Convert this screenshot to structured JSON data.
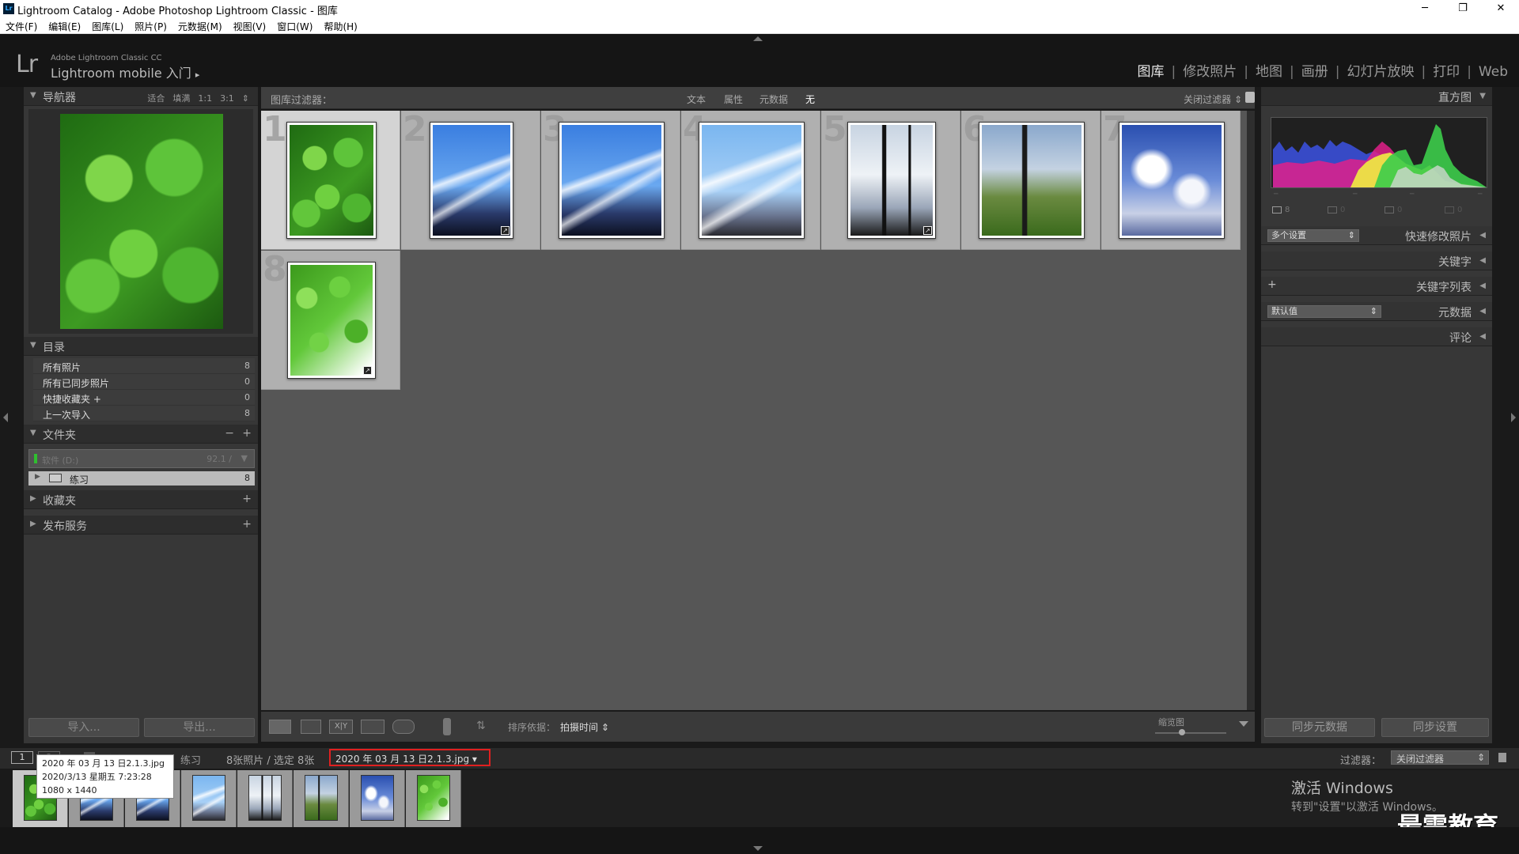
{
  "window": {
    "title": "Lightroom Catalog - Adobe Photoshop Lightroom Classic - 图库",
    "app_icon_text": "Lr"
  },
  "window_controls": {
    "minimize": "─",
    "restore": "❐",
    "close": "✕"
  },
  "menu": [
    "文件(F)",
    "编辑(E)",
    "图库(L)",
    "照片(P)",
    "元数据(M)",
    "视图(V)",
    "窗口(W)",
    "帮助(H)"
  ],
  "identity_plate": {
    "logo": "Lr",
    "line1": "Adobe Lightroom Classic CC",
    "line2": "Lightroom mobile 入门",
    "arrow": "▸"
  },
  "modules": {
    "items": [
      "图库",
      "修改照片",
      "地图",
      "画册",
      "幻灯片放映",
      "打印",
      "Web"
    ],
    "active": "图库",
    "separator": "|"
  },
  "navigator": {
    "title": "导航器",
    "options": [
      "适合",
      "填满",
      "1:1",
      "3:1"
    ],
    "spinner": "⇕"
  },
  "catalog": {
    "title": "目录",
    "items": [
      {
        "label": "所有照片",
        "count": "8"
      },
      {
        "label": "所有已同步照片",
        "count": "0"
      },
      {
        "label": "快捷收藏夹 +",
        "count": "0"
      },
      {
        "label": "上一次导入",
        "count": "8"
      }
    ]
  },
  "folders": {
    "title": "文件夹",
    "minus": "−",
    "plus": "+",
    "volume_name": "软件 (D:)",
    "volume_size": "92.1 /",
    "folder_name": "练习",
    "folder_count": "8"
  },
  "collections": {
    "title": "收藏夹",
    "plus": "+"
  },
  "publish": {
    "title": "发布服务",
    "plus": "+"
  },
  "left_buttons": {
    "import": "导入...",
    "export": "导出..."
  },
  "filter_bar": {
    "label": "图库过滤器：",
    "tabs": [
      "文本",
      "属性",
      "元数据",
      "无"
    ],
    "active": "无",
    "right": "关闭过滤器 ⇕",
    "lock_icon": "lock-icon"
  },
  "grid": {
    "cells": [
      {
        "num": "1",
        "kind": "clover",
        "badge": false,
        "selected": true
      },
      {
        "num": "2",
        "kind": "sky",
        "badge": true,
        "selected": false
      },
      {
        "num": "3",
        "kind": "sky",
        "badge": false,
        "selected": false
      },
      {
        "num": "4",
        "kind": "skylight",
        "badge": false,
        "selected": false
      },
      {
        "num": "5",
        "kind": "pole",
        "badge": true,
        "selected": false
      },
      {
        "num": "6",
        "kind": "polegreen",
        "badge": false,
        "selected": false
      },
      {
        "num": "7",
        "kind": "cloud",
        "badge": false,
        "selected": false
      },
      {
        "num": "8",
        "kind": "leaves",
        "badge": true,
        "selected": false
      }
    ]
  },
  "toolbar": {
    "sort_label": "排序依据：",
    "sort_value": "拍摄时间 ⇕",
    "thumb_label": "缩览图",
    "xy": "X|Y",
    "sort_icon": "az-sort-icon"
  },
  "right_panel": {
    "histogram": {
      "title": "直方图",
      "stats": [
        "8",
        "0",
        "0",
        "0"
      ]
    },
    "quick_develop": {
      "preset": "多个设置",
      "title": "快速修改照片"
    },
    "keywords": {
      "title": "关键字"
    },
    "keyword_list": {
      "title": "关键字列表",
      "plus": "+"
    },
    "metadata": {
      "preset": "默认值",
      "title": "元数据"
    },
    "comments": {
      "title": "评论"
    },
    "arrow": "◀",
    "buttons": {
      "sync_metadata": "同步元数据",
      "sync_settings": "同步设置"
    }
  },
  "filmstrip_bar": {
    "page1": "1",
    "page2": "2",
    "source": "文件夹：练习",
    "count": "8张照片 / 选定 8张",
    "selected_file": "2020 年 03 月 13 日2.1.3.jpg ▾",
    "filter_label": "过滤器：",
    "filter_value": "关闭过滤器"
  },
  "tooltip": {
    "line1": "2020 年 03 月 13 日2.1.3.jpg",
    "line2": "2020/3/13 星期五 7:23:28",
    "line3": "1080 x 1440"
  },
  "filmstrip": [
    "clover",
    "sky",
    "sky",
    "skylight",
    "pole",
    "polegreen",
    "cloud",
    "leaves"
  ],
  "activation": {
    "line1": "激活 Windows",
    "line2": "转到\"设置\"以激活 Windows。"
  },
  "watermark": "最需教育",
  "colors": {
    "accent_red": "#e02020",
    "panel": "#373737",
    "grid_bg": "#565656",
    "cell": "#b0b0b0",
    "cell_selected": "#d4d4d4"
  }
}
